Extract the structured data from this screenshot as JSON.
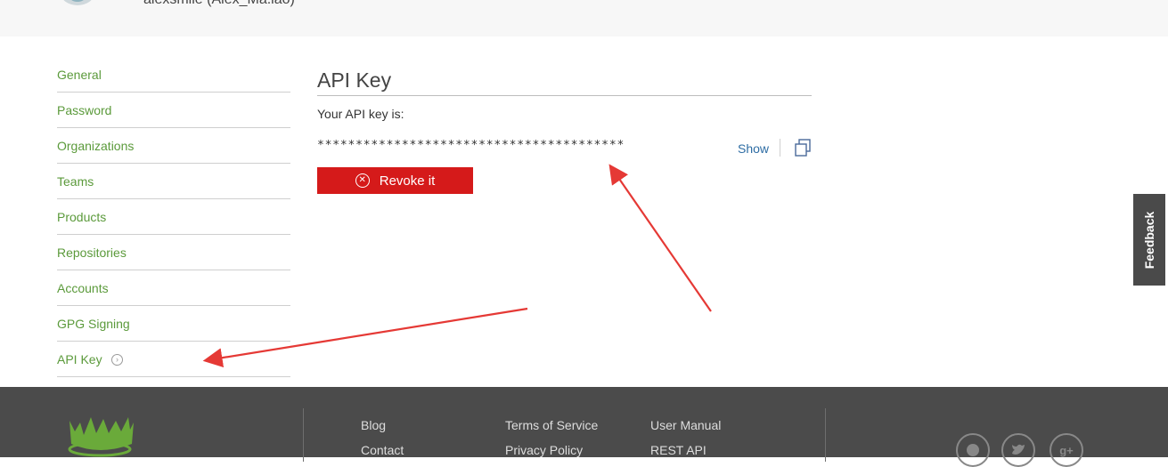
{
  "header": {
    "username": "alexsmile (Alex_Ma.iao)"
  },
  "sidebar": {
    "items": [
      {
        "label": "General"
      },
      {
        "label": "Password"
      },
      {
        "label": "Organizations"
      },
      {
        "label": "Teams"
      },
      {
        "label": "Products"
      },
      {
        "label": "Repositories"
      },
      {
        "label": "Accounts"
      },
      {
        "label": "GPG Signing"
      },
      {
        "label": "API Key",
        "active": true
      }
    ]
  },
  "main": {
    "title": "API Key",
    "api_label": "Your API key is:",
    "api_key_masked": "****************************************",
    "show_label": "Show",
    "revoke_label": "Revoke it"
  },
  "feedback": {
    "label": "Feedback"
  },
  "footer": {
    "links_col1": [
      "Blog",
      "Contact"
    ],
    "links_col2": [
      "Terms of Service",
      "Privacy Policy"
    ],
    "links_col3": [
      "User Manual",
      "REST API"
    ],
    "social_icons": [
      "github-icon",
      "twitter-icon",
      "google-plus-icon"
    ]
  },
  "colors": {
    "link_green": "#5b9a3b",
    "revoke_red": "#d51a1a",
    "annotation_red": "#e53935",
    "footer_bg": "#4b4b4b"
  }
}
